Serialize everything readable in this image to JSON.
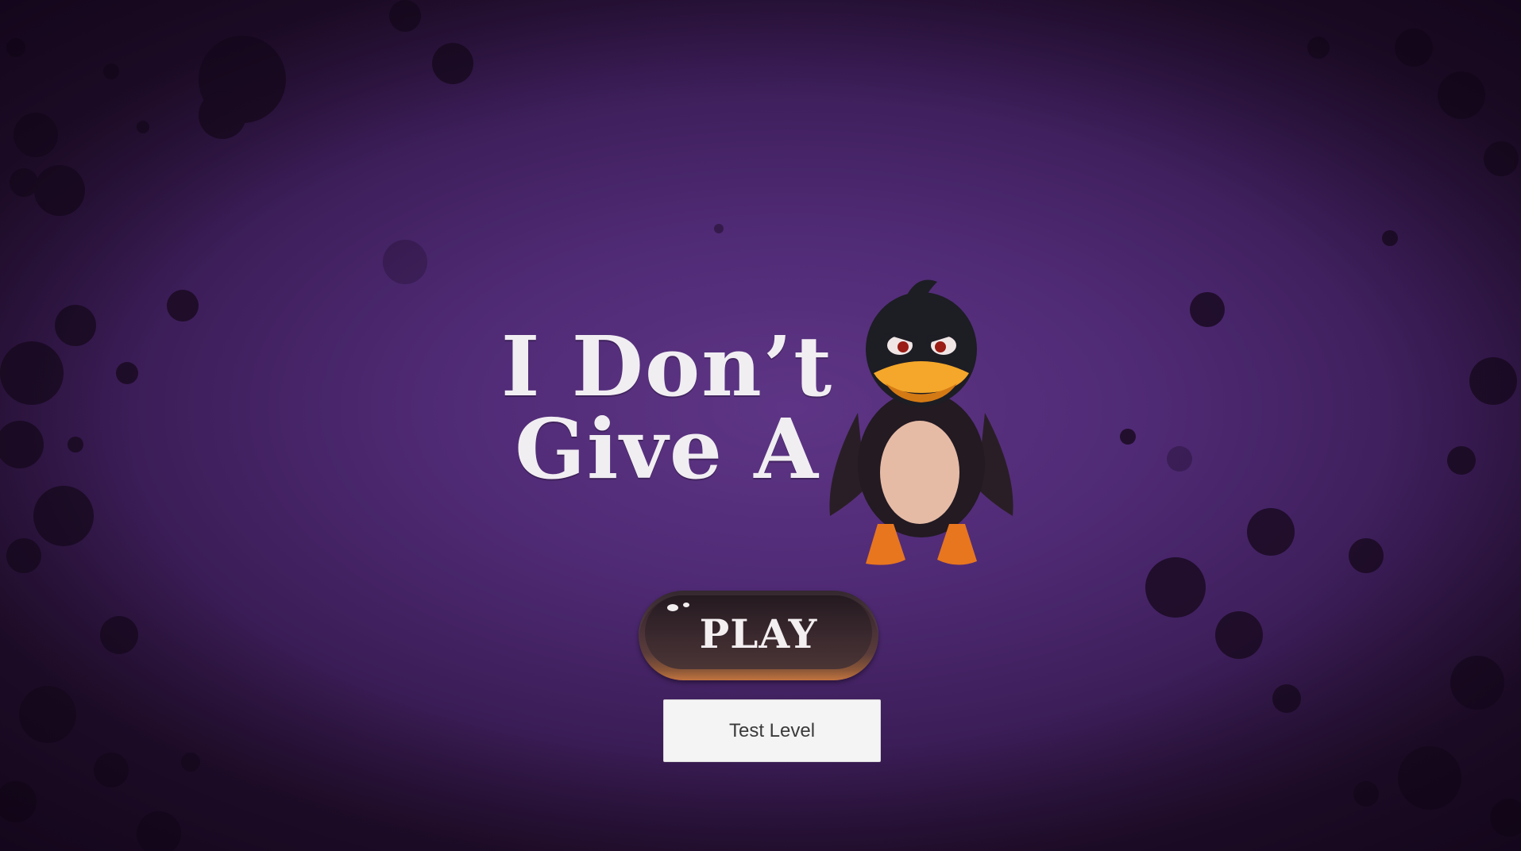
{
  "title": {
    "line1": "I Don’t",
    "line2": "Give A"
  },
  "menu": {
    "play_label": "PLAY",
    "test_level_label": "Test Level"
  },
  "icons": {
    "mascot": "angry-duck-icon"
  },
  "colors": {
    "background": "#4f2a74",
    "title_text": "#f1eef2",
    "play_button": "#3a292e",
    "play_button_rim": "#c1743f",
    "test_button_bg": "#f4f4f4"
  }
}
